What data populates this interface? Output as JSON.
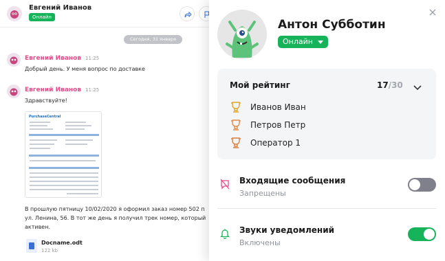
{
  "chat": {
    "header": {
      "name": "Евгений Иванов",
      "status": "Онлайн"
    },
    "date_separator": "Сегодня, 31 января",
    "messages": [
      {
        "author": "Евгений Иванов",
        "time": "11:25",
        "text": "Добрый день. У меня вопрос по доставке"
      },
      {
        "author": "Евгений Иванов",
        "time": "11:25",
        "greeting": "Здравствуйте!",
        "attachment_brand": "PurchaseCentral",
        "body_lines": [
          "В прошлую пятницу 10/02/2020 я оформил заказ номер 502 п",
          "ул. Ленина, 56. В тот же день я получил трек номер, который",
          "активен."
        ],
        "file": {
          "name": "Docname.odt",
          "size": "122 kb"
        }
      }
    ]
  },
  "panel": {
    "profile": {
      "name": "Антон Субботин",
      "status": "Онлайн"
    },
    "rating": {
      "title": "Мой рейтинг",
      "score": "17",
      "total": "/30",
      "ranks": [
        {
          "place": "1",
          "name": "Иванов Иван",
          "color": "#e0a526"
        },
        {
          "place": "2",
          "name": "Петров Петр",
          "color": "#e08a45"
        },
        {
          "place": "3",
          "name": "Оператор 1",
          "color": "#d87f3a"
        }
      ]
    },
    "settings": [
      {
        "title": "Входящие сообщения",
        "subtitle": "Запрещены",
        "enabled": false,
        "icon": "message-blocked-icon",
        "icon_color": "#e8498a"
      },
      {
        "title": "Звуки уведомлений",
        "subtitle": "Включены",
        "enabled": true,
        "icon": "bell-icon",
        "icon_color": "#16b35a"
      }
    ]
  },
  "colors": {
    "accent_green": "#16b35a",
    "author_pink": "#e8498a",
    "toggle_off": "#7f808c"
  }
}
